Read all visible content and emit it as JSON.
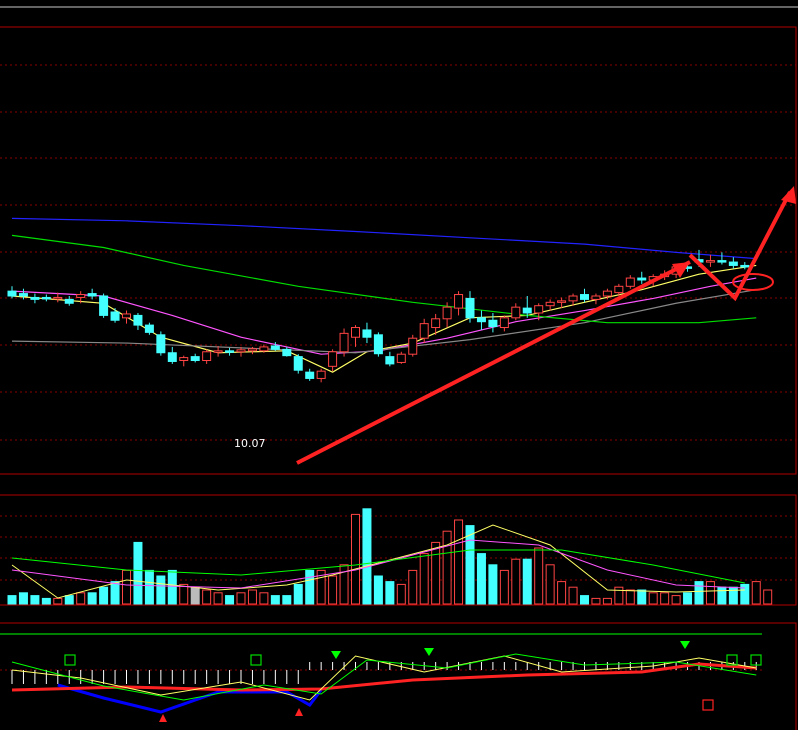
{
  "chart_data": [
    {
      "type": "candlestick",
      "panel": "price",
      "annotations": {
        "low_label": "10.07"
      },
      "ohlc": [
        [
          11.95,
          12.05,
          11.8,
          11.85
        ],
        [
          11.9,
          12.0,
          11.78,
          11.85
        ],
        [
          11.82,
          11.9,
          11.7,
          11.78
        ],
        [
          11.82,
          11.88,
          11.74,
          11.8
        ],
        [
          11.8,
          11.92,
          11.72,
          11.82
        ],
        [
          11.78,
          11.85,
          11.65,
          11.7
        ],
        [
          11.82,
          11.95,
          11.7,
          11.88
        ],
        [
          11.9,
          12.0,
          11.78,
          11.85
        ],
        [
          11.85,
          11.9,
          11.4,
          11.45
        ],
        [
          11.52,
          11.6,
          11.3,
          11.35
        ],
        [
          11.4,
          11.55,
          11.28,
          11.48
        ],
        [
          11.45,
          11.5,
          11.15,
          11.25
        ],
        [
          11.25,
          11.3,
          11.05,
          11.1
        ],
        [
          11.05,
          11.12,
          10.62,
          10.68
        ],
        [
          10.68,
          10.8,
          10.45,
          10.5
        ],
        [
          10.52,
          10.62,
          10.4,
          10.58
        ],
        [
          10.6,
          10.66,
          10.48,
          10.52
        ],
        [
          10.52,
          10.75,
          10.45,
          10.7
        ],
        [
          10.7,
          10.82,
          10.6,
          10.72
        ],
        [
          10.72,
          10.78,
          10.62,
          10.7
        ],
        [
          10.7,
          10.8,
          10.6,
          10.74
        ],
        [
          10.72,
          10.8,
          10.65,
          10.76
        ],
        [
          10.72,
          10.85,
          10.68,
          10.8
        ],
        [
          10.82,
          10.9,
          10.72,
          10.75
        ],
        [
          10.75,
          10.8,
          10.6,
          10.62
        ],
        [
          10.6,
          10.65,
          10.25,
          10.32
        ],
        [
          10.28,
          10.35,
          10.1,
          10.15
        ],
        [
          10.15,
          10.35,
          10.07,
          10.3
        ],
        [
          10.4,
          10.75,
          10.3,
          10.7
        ],
        [
          10.7,
          11.18,
          10.6,
          11.08
        ],
        [
          11.0,
          11.25,
          10.8,
          11.2
        ],
        [
          11.15,
          11.3,
          10.88,
          11.0
        ],
        [
          11.05,
          11.1,
          10.6,
          10.66
        ],
        [
          10.6,
          10.7,
          10.4,
          10.45
        ],
        [
          10.48,
          10.7,
          10.45,
          10.65
        ],
        [
          10.65,
          11.05,
          10.6,
          10.98
        ],
        [
          10.98,
          11.38,
          10.88,
          11.28
        ],
        [
          11.2,
          11.48,
          11.05,
          11.38
        ],
        [
          11.38,
          11.72,
          11.2,
          11.62
        ],
        [
          11.6,
          11.95,
          11.45,
          11.88
        ],
        [
          11.8,
          11.95,
          11.3,
          11.4
        ],
        [
          11.4,
          11.55,
          11.15,
          11.32
        ],
        [
          11.35,
          11.5,
          11.1,
          11.22
        ],
        [
          11.2,
          11.45,
          11.12,
          11.4
        ],
        [
          11.4,
          11.7,
          11.35,
          11.62
        ],
        [
          11.6,
          11.85,
          11.4,
          11.5
        ],
        [
          11.5,
          11.7,
          11.35,
          11.65
        ],
        [
          11.65,
          11.78,
          11.55,
          11.72
        ],
        [
          11.72,
          11.82,
          11.6,
          11.75
        ],
        [
          11.75,
          11.9,
          11.65,
          11.85
        ],
        [
          11.88,
          12.0,
          11.72,
          11.78
        ],
        [
          11.78,
          11.9,
          11.68,
          11.85
        ],
        [
          11.85,
          12.0,
          11.78,
          11.95
        ],
        [
          11.92,
          12.1,
          11.85,
          12.05
        ],
        [
          12.05,
          12.28,
          12.0,
          12.22
        ],
        [
          12.22,
          12.35,
          12.1,
          12.18
        ],
        [
          12.18,
          12.3,
          12.05,
          12.25
        ],
        [
          12.25,
          12.38,
          12.18,
          12.3
        ],
        [
          12.3,
          12.5,
          12.22,
          12.45
        ],
        [
          12.45,
          12.55,
          12.35,
          12.42
        ],
        [
          12.6,
          12.8,
          12.45,
          12.55
        ],
        [
          12.55,
          12.7,
          12.45,
          12.58
        ],
        [
          12.58,
          12.75,
          12.5,
          12.55
        ],
        [
          12.55,
          12.65,
          12.42,
          12.48
        ],
        [
          12.48,
          12.55,
          12.4,
          12.45
        ]
      ],
      "ma_lines": [
        {
          "color": "#ffff66",
          "points": [
            [
              0,
              11.85
            ],
            [
              8,
              11.7
            ],
            [
              13,
              11.0
            ],
            [
              18,
              10.68
            ],
            [
              24,
              10.72
            ],
            [
              28,
              10.28
            ],
            [
              31,
              10.7
            ],
            [
              35,
              10.88
            ],
            [
              40,
              11.4
            ],
            [
              45,
              11.45
            ],
            [
              50,
              11.72
            ],
            [
              55,
              11.98
            ],
            [
              60,
              12.3
            ],
            [
              65,
              12.48
            ]
          ]
        },
        {
          "color": "#ff55ff",
          "points": [
            [
              0,
              11.95
            ],
            [
              8,
              11.85
            ],
            [
              14,
              11.45
            ],
            [
              20,
              11.0
            ],
            [
              27,
              10.65
            ],
            [
              32,
              10.72
            ],
            [
              38,
              10.98
            ],
            [
              44,
              11.32
            ],
            [
              50,
              11.55
            ],
            [
              56,
              11.8
            ],
            [
              61,
              12.05
            ],
            [
              65,
              12.22
            ]
          ]
        },
        {
          "color": "#888888",
          "points": [
            [
              0,
              10.92
            ],
            [
              10,
              10.88
            ],
            [
              20,
              10.78
            ],
            [
              30,
              10.68
            ],
            [
              40,
              10.95
            ],
            [
              50,
              11.3
            ],
            [
              58,
              11.7
            ],
            [
              65,
              11.98
            ]
          ]
        },
        {
          "color": "#00dd00",
          "points": [
            [
              0,
              13.1
            ],
            [
              8,
              12.85
            ],
            [
              15,
              12.48
            ],
            [
              25,
              12.05
            ],
            [
              35,
              11.72
            ],
            [
              45,
              11.45
            ],
            [
              52,
              11.3
            ],
            [
              60,
              11.3
            ],
            [
              65,
              11.4
            ]
          ]
        },
        {
          "color": "#2222ff",
          "points": [
            [
              0,
              13.45
            ],
            [
              10,
              13.4
            ],
            [
              20,
              13.3
            ],
            [
              30,
              13.18
            ],
            [
              40,
              13.05
            ],
            [
              50,
              12.92
            ],
            [
              58,
              12.75
            ],
            [
              65,
              12.62
            ]
          ]
        }
      ]
    },
    {
      "type": "bar",
      "panel": "volume",
      "values": [
        3,
        4,
        3,
        2,
        2,
        3,
        4,
        4,
        6,
        8,
        12,
        22,
        12,
        10,
        12,
        7,
        6,
        5,
        4,
        3,
        4,
        5,
        4,
        3,
        3,
        7,
        12,
        12,
        10,
        14,
        32,
        34,
        10,
        8,
        7,
        12,
        18,
        22,
        26,
        30,
        28,
        18,
        14,
        12,
        16,
        16,
        20,
        14,
        8,
        6,
        3,
        2,
        2,
        6,
        5,
        5,
        4,
        4,
        3,
        4,
        8,
        8,
        6,
        6,
        7,
        8,
        5
      ]
    },
    {
      "type": "line",
      "panel": "indicator",
      "series_colors": [
        "#ff2222",
        "#ffff66",
        "#00ff00",
        "#0000ff"
      ]
    }
  ]
}
